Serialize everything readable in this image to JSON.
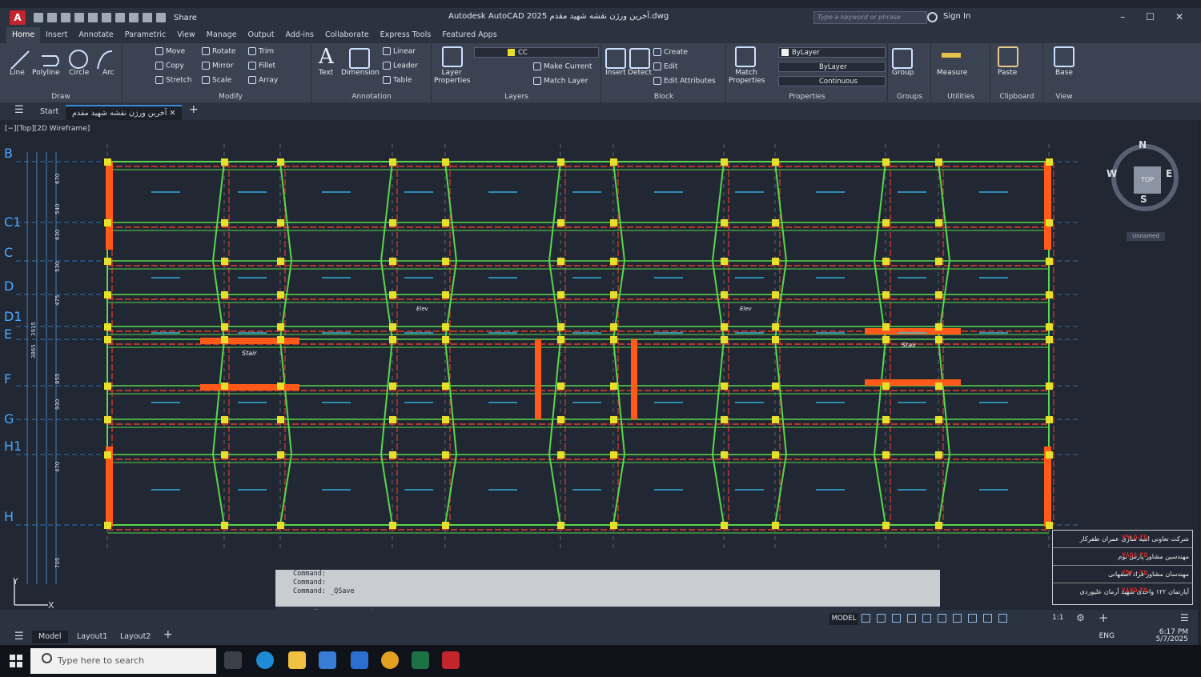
{
  "titlebar": {
    "share_label": "Share",
    "window_title": "Autodesk AutoCAD 2025  آخرین ورژن نقشه شهید مقدم.dwg",
    "search_placeholder": "Type a keyword or phrase",
    "sign_in": "Sign In"
  },
  "ribbon_tabs": [
    "Home",
    "Insert",
    "Annotate",
    "Parametric",
    "View",
    "Manage",
    "Output",
    "Add-ins",
    "Collaborate",
    "Express Tools",
    "Featured Apps"
  ],
  "draw": {
    "title": "Draw",
    "line": "Line",
    "polyline": "Polyline",
    "circle": "Circle",
    "arc": "Arc"
  },
  "modify": {
    "title": "Modify",
    "move": "Move",
    "rotate": "Rotate",
    "trim": "Trim",
    "copy": "Copy",
    "mirror": "Mirror",
    "fillet": "Fillet",
    "stretch": "Stretch",
    "scale": "Scale",
    "array": "Array"
  },
  "annotation": {
    "title": "Annotation",
    "text": "Text",
    "dimension": "Dimension",
    "linear": "Linear",
    "leader": "Leader",
    "table": "Table"
  },
  "layers": {
    "title": "Layers",
    "layer_properties": "Layer Properties",
    "current_layer": "CC",
    "make_current": "Make Current",
    "match_layer": "Match Layer"
  },
  "block": {
    "title": "Block",
    "insert": "Insert",
    "detect": "Detect",
    "create": "Create",
    "edit": "Edit",
    "edit_attributes": "Edit Attributes"
  },
  "properties": {
    "title": "Properties",
    "match_properties": "Match Properties",
    "color": "ByLayer",
    "lineweight": "ByLayer",
    "linetype": "Continuous"
  },
  "groups": {
    "title": "Groups",
    "group": "Group"
  },
  "utilities": {
    "title": "Utilities",
    "measure": "Measure"
  },
  "clipboard": {
    "title": "Clipboard",
    "paste": "Paste"
  },
  "view_panel": {
    "title": "View",
    "base": "Base"
  },
  "doc_tabs": {
    "start": "Start",
    "drawing": "آخرین ورژن نقشه شهید مقدم"
  },
  "viewport_label": "[−][Top][2D Wireframe]",
  "grid_labels": [
    "B",
    "C1",
    "C",
    "D",
    "D1",
    "E",
    "F",
    "G",
    "H1",
    "H"
  ],
  "dimensions_left": [
    "670",
    "540",
    "630",
    "530",
    "475",
    "3915",
    "3865",
    "855",
    "930",
    "470",
    "705"
  ],
  "viewcube": {
    "n": "N",
    "s": "S",
    "e": "E",
    "w": "W",
    "face": "TOP",
    "ucs": "Unnamed"
  },
  "plan_labels": {
    "stair": "Stair",
    "elev": "Elev"
  },
  "command_history": [
    "Command:",
    "Command:",
    "Command:  _QSave"
  ],
  "command_placeholder": "Type a command",
  "title_block": [
    {
      "text": "شرکت تعاونی ابنیه سازی عمران ظفرکار",
      "num": "۷۹۱۵-۲۵"
    },
    {
      "text": "مهندسین مشاور پارس بوم",
      "num": "۷۸۵۶-۲۵"
    },
    {
      "text": "مهندسان مشاور فراد اصفهانی",
      "num": "۷۹۶۰-۲۵"
    },
    {
      "text": "آپارتمان ۱۲۲ واحدی شهید آرمان علیوردی",
      "num": "۷۸۷۵-۲۵"
    }
  ],
  "status": {
    "model": "MODEL",
    "scale": "1:1"
  },
  "layout_tabs": [
    "Model",
    "Layout1",
    "Layout2"
  ],
  "tray": {
    "lang": "ENG",
    "time": "6:17 PM",
    "date": "5/7/2025"
  },
  "taskbar": {
    "search_placeholder": "Type here to search"
  },
  "colors": {
    "columns": "#e6e02a",
    "beams_green": "#58d84a",
    "beams_red": "#e23b2b",
    "walls_orange": "#ff5a1a",
    "annot_cyan": "#33c8ff",
    "grid_blue": "#4aa8ff"
  }
}
